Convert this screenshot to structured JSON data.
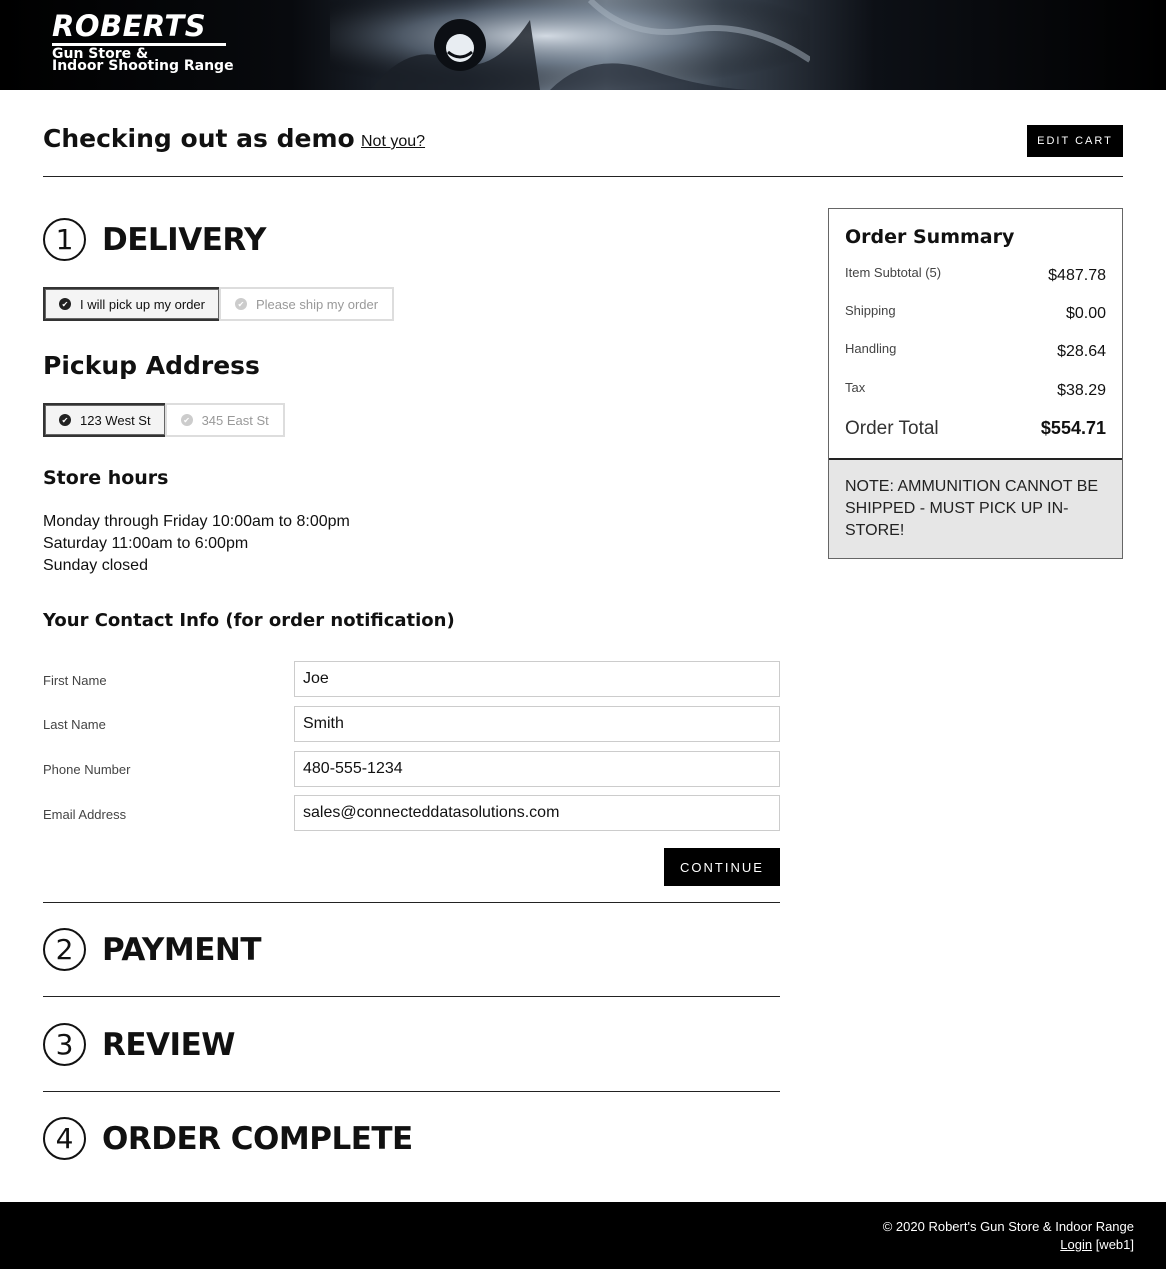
{
  "header": {
    "logo_main": "ROBERTS",
    "logo_sub_1": "Gun Store &",
    "logo_sub_2": "Indoor Shooting Range"
  },
  "checkout": {
    "title": "Checking out as demo",
    "not_you": "Not you?",
    "edit_cart": "EDIT CART"
  },
  "steps": [
    {
      "number": "1",
      "title": "DELIVERY"
    },
    {
      "number": "2",
      "title": "PAYMENT"
    },
    {
      "number": "3",
      "title": "REVIEW"
    },
    {
      "number": "4",
      "title": "ORDER COMPLETE"
    }
  ],
  "delivery": {
    "options": [
      {
        "label": "I will pick up my order",
        "selected": true
      },
      {
        "label": "Please ship my order",
        "selected": false
      }
    ],
    "pickup_title": "Pickup Address",
    "pickup_options": [
      {
        "label": "123 West St",
        "selected": true
      },
      {
        "label": "345 East St",
        "selected": false
      }
    ],
    "store_hours_title": "Store hours",
    "hours": [
      "Monday through Friday 10:00am to 8:00pm",
      "Saturday 11:00am to 6:00pm",
      "Sunday closed"
    ],
    "contact_title": "Your Contact Info (for order notification)"
  },
  "form": {
    "first_name_label": "First Name",
    "first_name_value": "Joe",
    "last_name_label": "Last Name",
    "last_name_value": "Smith",
    "phone_label": "Phone Number",
    "phone_value": "480-555-1234",
    "email_label": "Email Address",
    "email_value": "sales@connecteddatasolutions.com",
    "continue_label": "CONTINUE"
  },
  "summary": {
    "title": "Order Summary",
    "rows": [
      {
        "label": "Item Subtotal (5)",
        "value": "$487.78"
      },
      {
        "label": "Shipping",
        "value": "$0.00"
      },
      {
        "label": "Handling",
        "value": "$28.64"
      },
      {
        "label": "Tax",
        "value": "$38.29"
      }
    ],
    "total_label": "Order Total",
    "total_value": "$554.71",
    "note": "NOTE: AMMUNITION CANNOT BE SHIPPED - MUST PICK UP IN-STORE!"
  },
  "footer": {
    "copyright": "© 2020 Robert's Gun Store & Indoor Range",
    "login_label": "Login",
    "server_tag": "[web1]"
  },
  "colors": {
    "primary": "#000000",
    "note_background": "#e6e6e6"
  }
}
